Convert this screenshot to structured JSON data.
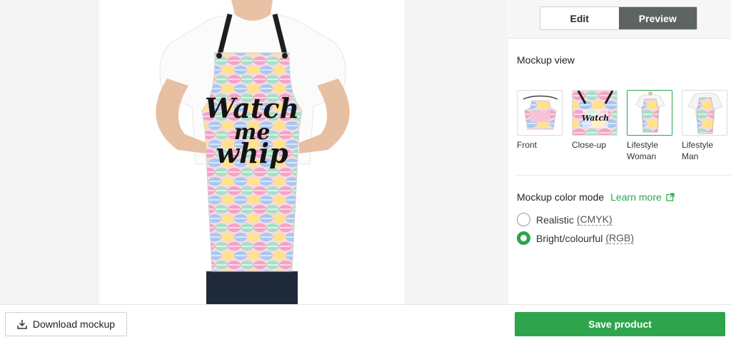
{
  "mode_toggle": {
    "edit_label": "Edit",
    "preview_label": "Preview",
    "active": "Preview"
  },
  "mockup_view": {
    "title": "Mockup view",
    "selected": "Lifestyle Woman",
    "thumbnails": [
      {
        "label_line1": "Front",
        "label_line2": ""
      },
      {
        "label_line1": "Close-up",
        "label_line2": ""
      },
      {
        "label_line1": "Lifestyle",
        "label_line2": "Woman"
      },
      {
        "label_line1": "Lifestyle",
        "label_line2": "Man"
      }
    ]
  },
  "color_mode": {
    "title": "Mockup color mode",
    "learn_more": "Learn more",
    "options": [
      {
        "label": "Realistic",
        "note": "(CMYK)",
        "checked": false
      },
      {
        "label": "Bright/colourful",
        "note": "(RGB)",
        "checked": true
      }
    ]
  },
  "preview": {
    "apron_text": [
      "Watch",
      "me",
      "whip"
    ]
  },
  "footer": {
    "download_label": "Download mockup",
    "save_label": "Save product"
  },
  "colors": {
    "accent": "#2ea54d",
    "toggle_active": "#5d6463"
  }
}
